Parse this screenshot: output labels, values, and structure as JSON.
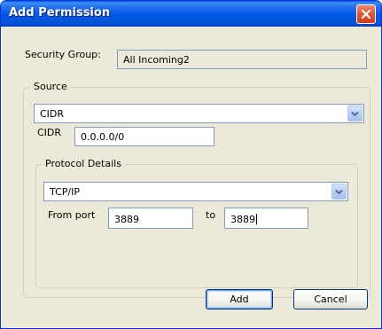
{
  "window": {
    "title": "Add Permission"
  },
  "security_group": {
    "label": "Security Group:",
    "value": "All Incoming2"
  },
  "source": {
    "group_title": "Source",
    "type_select": {
      "selected": "CIDR"
    },
    "cidr": {
      "label": "CIDR",
      "value": "0.0.0.0/0"
    }
  },
  "protocol_details": {
    "group_title": "Protocol Details",
    "protocol_select": {
      "selected": "TCP/IP"
    },
    "from_port": {
      "label": "From port",
      "value": "3889"
    },
    "to_port": {
      "label": "to",
      "value": "3889"
    }
  },
  "buttons": {
    "add": "Add",
    "cancel": "Cancel"
  },
  "icons": {
    "close": "close-icon",
    "dropdown": "chevron-down-icon"
  },
  "colors": {
    "titlebar": "#0058e6",
    "close_button": "#e35a33",
    "dialog_bg": "#ece9d8",
    "field_border": "#7f9db9"
  }
}
